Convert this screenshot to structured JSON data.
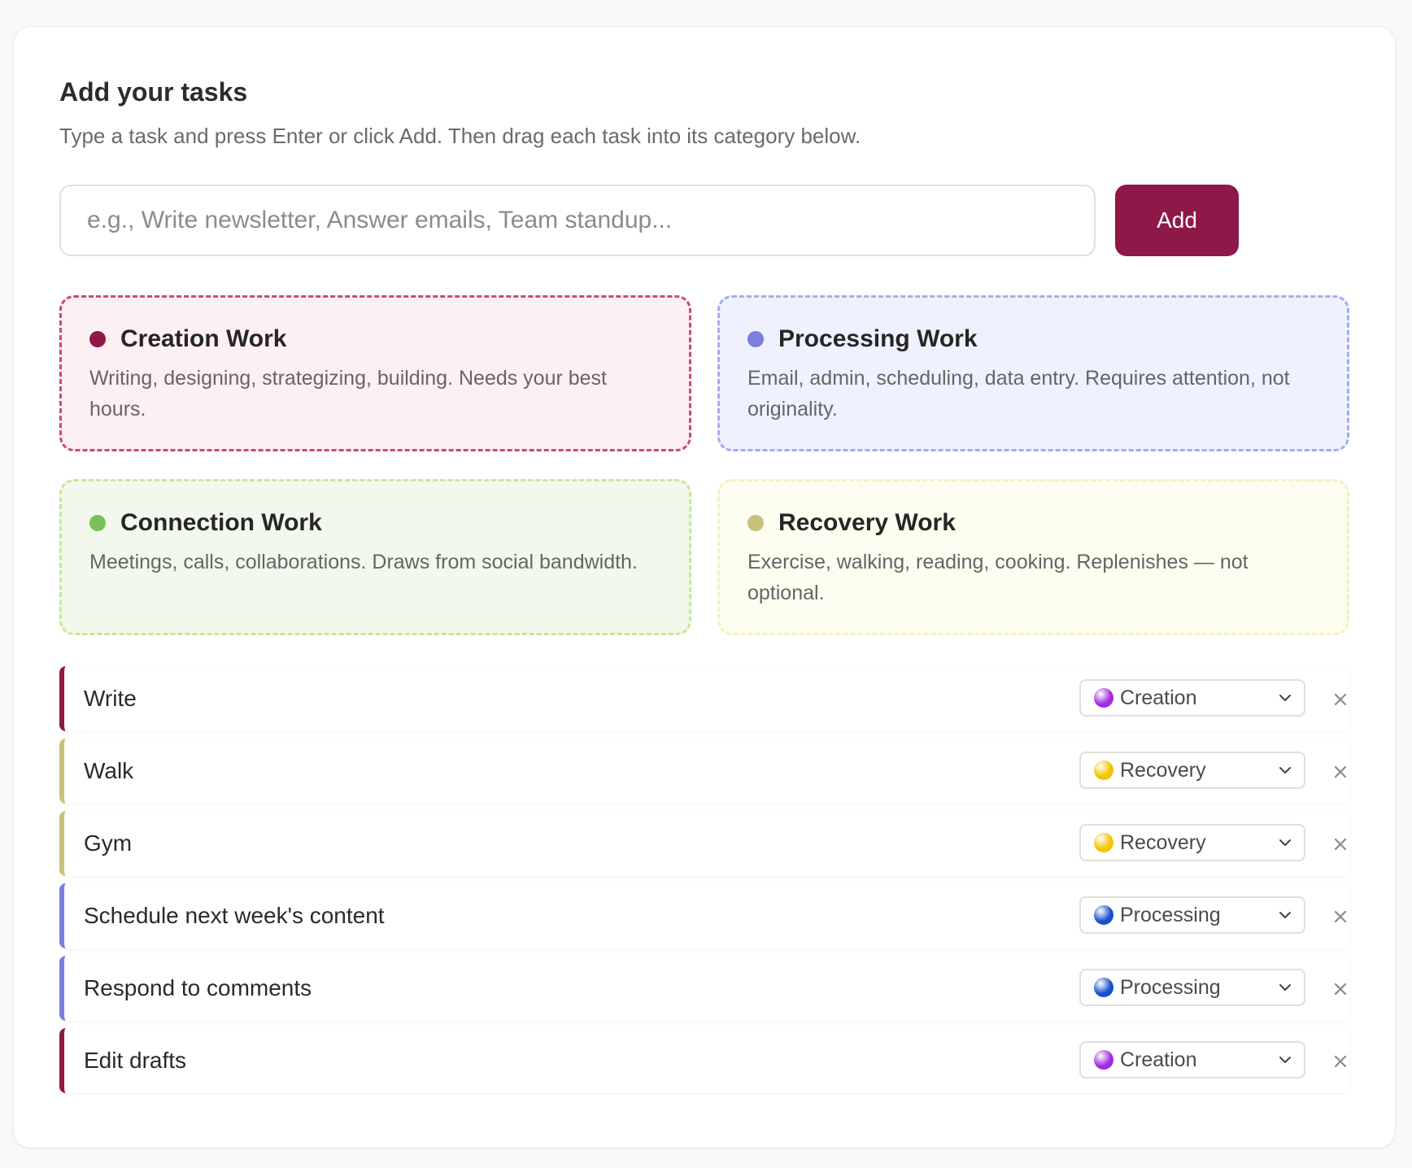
{
  "header": {
    "title": "Add your tasks",
    "subtitle": "Type a task and press Enter or click Add. Then drag each task into its category below."
  },
  "input": {
    "value": "",
    "placeholder": "e.g., Write newsletter, Answer emails, Team standup...",
    "add_label": "Add"
  },
  "colors": {
    "accent": "#8e1848",
    "creation": "#8e1848",
    "processing": "#7b7fdd",
    "connection": "#78c257",
    "recovery": "#c7c27a",
    "emoji_creation": "#a02be0",
    "emoji_recovery": "#f2c500",
    "emoji_processing": "#1650cc"
  },
  "categories": [
    {
      "title": "Creation Work",
      "description": "Writing, designing, strategizing, building. Needs your best hours.",
      "dot_color": "#8e1848",
      "border_color": "#c9497a",
      "bg_color": "#fdf0f3"
    },
    {
      "title": "Processing Work",
      "description": "Email, admin, scheduling, data entry. Requires attention, not originality.",
      "dot_color": "#7b7fdd",
      "border_color": "#a5abf2",
      "bg_color": "#eff1fe"
    },
    {
      "title": "Connection Work",
      "description": "Meetings, calls, collaborations. Draws from social bandwidth.",
      "dot_color": "#78c257",
      "border_color": "#c5e79c",
      "bg_color": "#f2f9ec"
    },
    {
      "title": "Recovery Work",
      "description": "Exercise, walking, reading, cooking. Replenishes — not optional.",
      "dot_color": "#c7c27a",
      "border_color": "#f4f1c0",
      "bg_color": "#fdfdf0"
    }
  ],
  "tasks": [
    {
      "name": "Write",
      "category": "Creation",
      "bar_color": "#8e1848",
      "emoji_color": "#a02be0"
    },
    {
      "name": "Walk",
      "category": "Recovery",
      "bar_color": "#c7c27a",
      "emoji_color": "#f2c500"
    },
    {
      "name": "Gym",
      "category": "Recovery",
      "bar_color": "#c7c27a",
      "emoji_color": "#f2c500"
    },
    {
      "name": "Schedule next week's content",
      "category": "Processing",
      "bar_color": "#7b7fdd",
      "emoji_color": "#1650cc"
    },
    {
      "name": "Respond to comments",
      "category": "Processing",
      "bar_color": "#7b7fdd",
      "emoji_color": "#1650cc"
    },
    {
      "name": "Edit drafts",
      "category": "Creation",
      "bar_color": "#8e1848",
      "emoji_color": "#a02be0"
    }
  ]
}
